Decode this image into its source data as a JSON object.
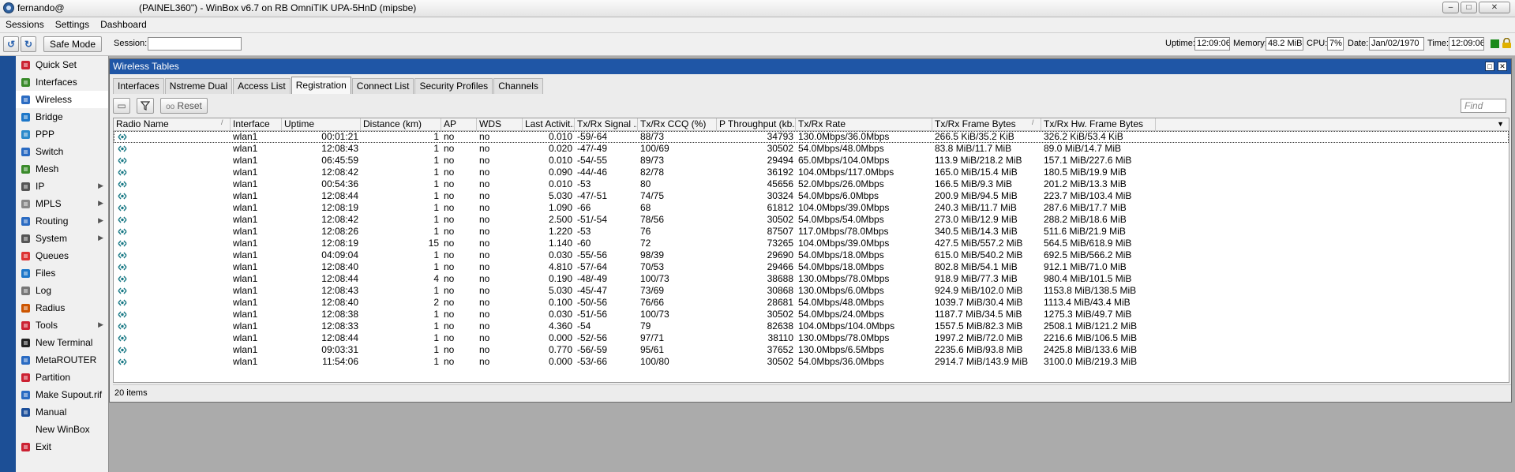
{
  "window": {
    "title_user": "fernando@",
    "title_rest": "(PAINEL360\") - WinBox v6.7 on RB OmniTIK UPA-5HnD (mipsbe)",
    "controls": [
      "–",
      "□",
      "✕"
    ]
  },
  "menubar": {
    "items": [
      "Sessions",
      "Settings",
      "Dashboard"
    ]
  },
  "toolbar": {
    "undo": "↺",
    "redo": "↻",
    "safe_mode": "Safe Mode",
    "session_label": "Session:",
    "session_value": "",
    "uptime_label": "Uptime:",
    "uptime_value": "12:09:06",
    "memory_label": "Memory:",
    "memory_value": "48.2 MiB",
    "cpu_label": "CPU:",
    "cpu_value": "7%",
    "date_label": "Date:",
    "date_value": "Jan/02/1970",
    "time_label": "Time:",
    "time_value": "12:09:06",
    "status_color": "#1a8a1a",
    "lock_color": "#e0b000"
  },
  "sidebar": {
    "items": [
      {
        "label": "Quick Set",
        "icon": "quick-set-icon",
        "submenu": false
      },
      {
        "label": "Interfaces",
        "icon": "interfaces-icon",
        "submenu": false
      },
      {
        "label": "Wireless",
        "icon": "wireless-icon",
        "submenu": false,
        "active": true
      },
      {
        "label": "Bridge",
        "icon": "bridge-icon",
        "submenu": false
      },
      {
        "label": "PPP",
        "icon": "ppp-icon",
        "submenu": false
      },
      {
        "label": "Switch",
        "icon": "switch-icon",
        "submenu": false
      },
      {
        "label": "Mesh",
        "icon": "mesh-icon",
        "submenu": false
      },
      {
        "label": "IP",
        "icon": "ip-icon",
        "submenu": true
      },
      {
        "label": "MPLS",
        "icon": "mpls-icon",
        "submenu": true
      },
      {
        "label": "Routing",
        "icon": "routing-icon",
        "submenu": true
      },
      {
        "label": "System",
        "icon": "system-icon",
        "submenu": true
      },
      {
        "label": "Queues",
        "icon": "queues-icon",
        "submenu": false
      },
      {
        "label": "Files",
        "icon": "files-icon",
        "submenu": false
      },
      {
        "label": "Log",
        "icon": "log-icon",
        "submenu": false
      },
      {
        "label": "Radius",
        "icon": "radius-icon",
        "submenu": false
      },
      {
        "label": "Tools",
        "icon": "tools-icon",
        "submenu": true
      },
      {
        "label": "New Terminal",
        "icon": "terminal-icon",
        "submenu": false
      },
      {
        "label": "MetaROUTER",
        "icon": "metarouter-icon",
        "submenu": false
      },
      {
        "label": "Partition",
        "icon": "partition-icon",
        "submenu": false
      },
      {
        "label": "Make Supout.rif",
        "icon": "supout-icon",
        "submenu": false
      },
      {
        "label": "Manual",
        "icon": "manual-icon",
        "submenu": false
      },
      {
        "label": "New WinBox",
        "icon": "",
        "submenu": false
      },
      {
        "label": "Exit",
        "icon": "exit-icon",
        "submenu": false
      }
    ]
  },
  "wireless": {
    "title": "Wireless Tables",
    "tabs": [
      "Interfaces",
      "Nstreme Dual",
      "Access List",
      "Registration",
      "Connect List",
      "Security Profiles",
      "Channels"
    ],
    "active_tab": "Registration",
    "reset_label": "Reset",
    "reset_prefix": "oo",
    "find_placeholder": "Find",
    "columns": [
      "Radio Name",
      "Interface",
      "Uptime",
      "Distance (km)",
      "AP",
      "WDS",
      "Last Activit...",
      "Tx/Rx Signal ...",
      "Tx/Rx CCQ (%)",
      "P Throughput (kb...",
      "Tx/Rx Rate",
      "Tx/Rx Frame Bytes",
      "Tx/Rx Hw. Frame Bytes"
    ],
    "rows": [
      [
        "",
        "wlan1",
        "00:01:21",
        "1",
        "no",
        "no",
        "0.010",
        "-59/-64",
        "88/73",
        "34793",
        "130.0Mbps/36.0Mbps",
        "266.5 KiB/35.2 KiB",
        "326.2 KiB/53.4 KiB"
      ],
      [
        "",
        "wlan1",
        "12:08:43",
        "1",
        "no",
        "no",
        "0.020",
        "-47/-49",
        "100/69",
        "30502",
        "54.0Mbps/48.0Mbps",
        "83.8 MiB/11.7 MiB",
        "89.0 MiB/14.7 MiB"
      ],
      [
        "",
        "wlan1",
        "06:45:59",
        "1",
        "no",
        "no",
        "0.010",
        "-54/-55",
        "89/73",
        "29494",
        "65.0Mbps/104.0Mbps",
        "113.9 MiB/218.2 MiB",
        "157.1 MiB/227.6 MiB"
      ],
      [
        "",
        "wlan1",
        "12:08:42",
        "1",
        "no",
        "no",
        "0.090",
        "-44/-46",
        "82/78",
        "36192",
        "104.0Mbps/117.0Mbps",
        "165.0 MiB/15.4 MiB",
        "180.5 MiB/19.9 MiB"
      ],
      [
        "",
        "wlan1",
        "00:54:36",
        "1",
        "no",
        "no",
        "0.010",
        "-53",
        "80",
        "45656",
        "52.0Mbps/26.0Mbps",
        "166.5 MiB/9.3 MiB",
        "201.2 MiB/13.3 MiB"
      ],
      [
        "",
        "wlan1",
        "12:08:44",
        "1",
        "no",
        "no",
        "5.030",
        "-47/-51",
        "74/75",
        "30324",
        "54.0Mbps/6.0Mbps",
        "200.9 MiB/94.5 MiB",
        "223.7 MiB/103.4 MiB"
      ],
      [
        "",
        "wlan1",
        "12:08:19",
        "1",
        "no",
        "no",
        "1.090",
        "-66",
        "68",
        "61812",
        "104.0Mbps/39.0Mbps",
        "240.3 MiB/11.7 MiB",
        "287.6 MiB/17.7 MiB"
      ],
      [
        "",
        "wlan1",
        "12:08:42",
        "1",
        "no",
        "no",
        "2.500",
        "-51/-54",
        "78/56",
        "30502",
        "54.0Mbps/54.0Mbps",
        "273.0 MiB/12.9 MiB",
        "288.2 MiB/18.6 MiB"
      ],
      [
        "",
        "wlan1",
        "12:08:26",
        "1",
        "no",
        "no",
        "1.220",
        "-53",
        "76",
        "87507",
        "117.0Mbps/78.0Mbps",
        "340.5 MiB/14.3 MiB",
        "511.6 MiB/21.9 MiB"
      ],
      [
        "",
        "wlan1",
        "12:08:19",
        "15",
        "no",
        "no",
        "1.140",
        "-60",
        "72",
        "73265",
        "104.0Mbps/39.0Mbps",
        "427.5 MiB/557.2 MiB",
        "564.5 MiB/618.9 MiB"
      ],
      [
        "",
        "wlan1",
        "04:09:04",
        "1",
        "no",
        "no",
        "0.030",
        "-55/-56",
        "98/39",
        "29690",
        "54.0Mbps/18.0Mbps",
        "615.0 MiB/540.2 MiB",
        "692.5 MiB/566.2 MiB"
      ],
      [
        "",
        "wlan1",
        "12:08:40",
        "1",
        "no",
        "no",
        "4.810",
        "-57/-64",
        "70/53",
        "29466",
        "54.0Mbps/18.0Mbps",
        "802.8 MiB/54.1 MiB",
        "912.1 MiB/71.0 MiB"
      ],
      [
        "",
        "wlan1",
        "12:08:44",
        "4",
        "no",
        "no",
        "0.190",
        "-48/-49",
        "100/73",
        "38688",
        "130.0Mbps/78.0Mbps",
        "918.9 MiB/77.3 MiB",
        "980.4 MiB/101.5 MiB"
      ],
      [
        "",
        "wlan1",
        "12:08:43",
        "1",
        "no",
        "no",
        "5.030",
        "-45/-47",
        "73/69",
        "30868",
        "130.0Mbps/6.0Mbps",
        "924.9 MiB/102.0 MiB",
        "1153.8 MiB/138.5 MiB"
      ],
      [
        "",
        "wlan1",
        "12:08:40",
        "2",
        "no",
        "no",
        "0.100",
        "-50/-56",
        "76/66",
        "28681",
        "54.0Mbps/48.0Mbps",
        "1039.7 MiB/30.4 MiB",
        "1113.4 MiB/43.4 MiB"
      ],
      [
        "",
        "wlan1",
        "12:08:38",
        "1",
        "no",
        "no",
        "0.030",
        "-51/-56",
        "100/73",
        "30502",
        "54.0Mbps/24.0Mbps",
        "1187.7 MiB/34.5 MiB",
        "1275.3 MiB/49.7 MiB"
      ],
      [
        "",
        "wlan1",
        "12:08:33",
        "1",
        "no",
        "no",
        "4.360",
        "-54",
        "79",
        "82638",
        "104.0Mbps/104.0Mbps",
        "1557.5 MiB/82.3 MiB",
        "2508.1 MiB/121.2 MiB"
      ],
      [
        "",
        "wlan1",
        "12:08:44",
        "1",
        "no",
        "no",
        "0.000",
        "-52/-56",
        "97/71",
        "38110",
        "130.0Mbps/78.0Mbps",
        "1997.2 MiB/72.0 MiB",
        "2216.6 MiB/106.5 MiB"
      ],
      [
        "",
        "wlan1",
        "09:03:31",
        "1",
        "no",
        "no",
        "0.770",
        "-56/-59",
        "95/61",
        "37652",
        "130.0Mbps/6.5Mbps",
        "2235.6 MiB/93.8 MiB",
        "2425.8 MiB/133.6 MiB"
      ],
      [
        "",
        "wlan1",
        "11:54:06",
        "1",
        "no",
        "no",
        "0.000",
        "-53/-66",
        "100/80",
        "30502",
        "54.0Mbps/36.0Mbps",
        "2914.7 MiB/143.9 MiB",
        "3100.0 MiB/219.3 MiB"
      ]
    ],
    "footer": "20 items"
  }
}
